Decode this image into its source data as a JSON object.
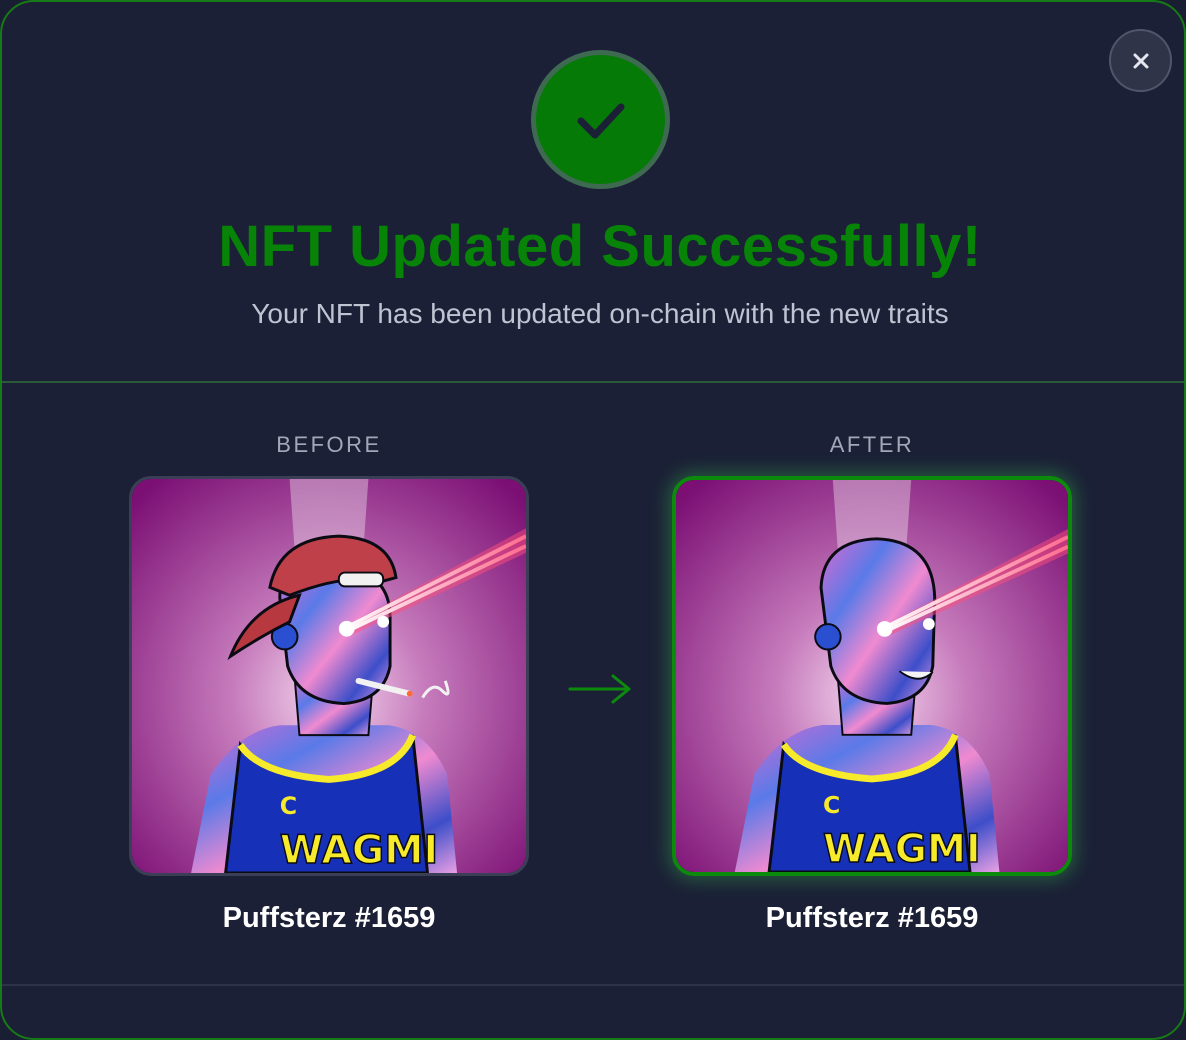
{
  "dialog": {
    "title": "NFT Updated Successfully!",
    "subtitle": "Your NFT has been updated on-chain with the new traits",
    "close_icon": "close-icon",
    "success_icon": "checkmark-icon",
    "accent_color": "#078307"
  },
  "comparison": {
    "before": {
      "label": "BEFORE",
      "name": "Puffsterz #1659",
      "jersey_text": "WAGMI",
      "jersey_letter": "C"
    },
    "after": {
      "label": "AFTER",
      "name": "Puffsterz #1659",
      "jersey_text": "WAGMI",
      "jersey_letter": "C"
    },
    "arrow_icon": "arrow-right-icon"
  }
}
